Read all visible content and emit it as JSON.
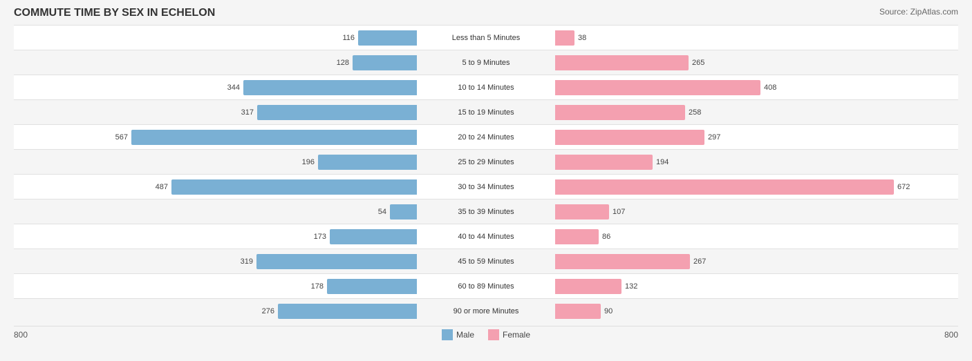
{
  "title": "COMMUTE TIME BY SEX IN ECHELON",
  "source": "Source: ZipAtlas.com",
  "maxValue": 800,
  "scaleLeft": "800",
  "scaleRight": "800",
  "colors": {
    "male": "#7ab0d4",
    "female": "#f4a0b0"
  },
  "legend": {
    "male": "Male",
    "female": "Female"
  },
  "rows": [
    {
      "label": "Less than 5 Minutes",
      "male": 116,
      "female": 38
    },
    {
      "label": "5 to 9 Minutes",
      "male": 128,
      "female": 265
    },
    {
      "label": "10 to 14 Minutes",
      "male": 344,
      "female": 408
    },
    {
      "label": "15 to 19 Minutes",
      "male": 317,
      "female": 258
    },
    {
      "label": "20 to 24 Minutes",
      "male": 567,
      "female": 297
    },
    {
      "label": "25 to 29 Minutes",
      "male": 196,
      "female": 194
    },
    {
      "label": "30 to 34 Minutes",
      "male": 487,
      "female": 672
    },
    {
      "label": "35 to 39 Minutes",
      "male": 54,
      "female": 107
    },
    {
      "label": "40 to 44 Minutes",
      "male": 173,
      "female": 86
    },
    {
      "label": "45 to 59 Minutes",
      "male": 319,
      "female": 267
    },
    {
      "label": "60 to 89 Minutes",
      "male": 178,
      "female": 132
    },
    {
      "label": "90 or more Minutes",
      "male": 276,
      "female": 90
    }
  ]
}
